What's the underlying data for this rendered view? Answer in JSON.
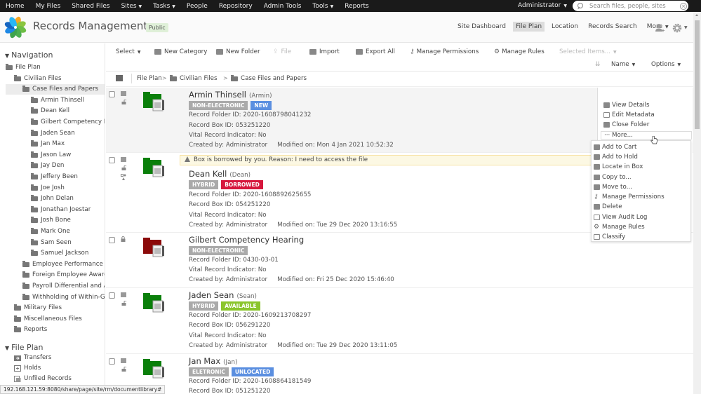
{
  "topbar": {
    "items": [
      {
        "label": "Home"
      },
      {
        "label": "My Files"
      },
      {
        "label": "Shared Files"
      },
      {
        "label": "Sites",
        "has_caret": true
      },
      {
        "label": "Tasks",
        "has_caret": true
      },
      {
        "label": "People"
      },
      {
        "label": "Repository"
      },
      {
        "label": "Admin Tools"
      },
      {
        "label": "Tools",
        "has_caret": true
      },
      {
        "label": "Reports"
      }
    ],
    "user": "Administrator",
    "search_placeholder": "Search files, people, sites"
  },
  "header": {
    "site_title": "Records Management",
    "visibility": "Public",
    "nav": [
      {
        "label": "Site Dashboard",
        "active": false
      },
      {
        "label": "File Plan",
        "active": true
      },
      {
        "label": "Location",
        "active": false
      },
      {
        "label": "Records Search",
        "active": false
      },
      {
        "label": "More",
        "active": false
      }
    ]
  },
  "sidebar": {
    "navigation_title": "Navigation",
    "tree": [
      {
        "label": "File Plan",
        "level": 0
      },
      {
        "label": "Civilian Files",
        "level": 1
      },
      {
        "label": "Case Files and Papers",
        "level": 2,
        "selected": true
      },
      {
        "label": "Armin Thinsell",
        "level": 3
      },
      {
        "label": "Dean Kell",
        "level": 3
      },
      {
        "label": "Gilbert Competency He",
        "level": 3
      },
      {
        "label": "Jaden Sean",
        "level": 3
      },
      {
        "label": "Jan Max",
        "level": 3
      },
      {
        "label": "Jason Law",
        "level": 3
      },
      {
        "label": "Jay Den",
        "level": 3
      },
      {
        "label": "Jeffery Been",
        "level": 3
      },
      {
        "label": "Joe Josh",
        "level": 3
      },
      {
        "label": "John Delan",
        "level": 3
      },
      {
        "label": "Jonathan Joestar",
        "level": 3
      },
      {
        "label": "Josh Bone",
        "level": 3
      },
      {
        "label": "Mark One",
        "level": 3
      },
      {
        "label": "Sam Seen",
        "level": 3
      },
      {
        "label": "Samuel Jackson",
        "level": 3
      },
      {
        "label": "Employee Performance File",
        "level": 2
      },
      {
        "label": "Foreign Employee Award F",
        "level": 2
      },
      {
        "label": "Payroll Differential and Allo",
        "level": 2
      },
      {
        "label": "Withholding of Within-Grad",
        "level": 2
      },
      {
        "label": "Military Files",
        "level": 1
      },
      {
        "label": "Miscellaneous Files",
        "level": 1
      },
      {
        "label": "Reports",
        "level": 1
      }
    ],
    "fileplan_title": "File Plan",
    "fileplan_items": [
      {
        "label": "Transfers"
      },
      {
        "label": "Holds"
      },
      {
        "label": "Unfiled Records"
      }
    ]
  },
  "toolbar": {
    "select": "Select",
    "new_category": "New Category",
    "new_folder": "New Folder",
    "file": "File",
    "import": "Import",
    "export_all": "Export All",
    "manage_permissions": "Manage Permissions",
    "manage_rules": "Manage Rules",
    "selected_items": "Selected Items...",
    "sort_by": "Name",
    "options": "Options"
  },
  "breadcrumb": [
    "File Plan",
    "Civilian Files",
    "Case Files and Papers"
  ],
  "colors": {
    "folder_green": "#0a7f0a",
    "folder_red": "#8b0a0a",
    "badge_gray": "#aaaaaa",
    "badge_new": "#5b8fe0",
    "badge_borrowed": "#d6173d",
    "badge_available": "#8ac52c",
    "badge_unlocated": "#5b8fe0"
  },
  "records": [
    {
      "title": "Armin Thinsell",
      "alias": "(Armin)",
      "badges": [
        {
          "text": "NON-ELECTRONIC",
          "color": "gray"
        },
        {
          "text": "NEW",
          "color": "new"
        }
      ],
      "folder_id": "Record Folder ID: 2020-1608798041232",
      "box_id": "Record Box ID: 053251220",
      "vital": "Vital Record Indicator: No",
      "created": "Created by: Administrator",
      "modified": "Modified on: Mon 4 Jan 2021 10:52:32"
    },
    {
      "warning": "Box is borrowed by you. Reason: I need to access the file",
      "title": "Dean Kell",
      "alias": "(Dean)",
      "badges": [
        {
          "text": "HYBRID",
          "color": "gray"
        },
        {
          "text": "BORROWED",
          "color": "borrowed"
        }
      ],
      "folder_id": "Record Folder ID: 2020-1608892625655",
      "box_id": "Record Box ID: 054251220",
      "vital": "Vital Record Indicator: No",
      "created": "Created by: Administrator",
      "modified": "Modified on: Tue 29 Dec 2020 13:16:55"
    },
    {
      "title": "Gilbert Competency Hearing",
      "alias": "",
      "badges": [
        {
          "text": "NON-ELECTRONIC",
          "color": "gray"
        }
      ],
      "folder_id": "Record Folder ID: 0430-03-01",
      "vital": "Vital Record Indicator: No",
      "created": "Created by: Administrator",
      "modified": "Modified on: Fri 25 Dec 2020 15:46:40"
    },
    {
      "title": "Jaden Sean",
      "alias": "(Sean)",
      "badges": [
        {
          "text": "HYBRID",
          "color": "gray"
        },
        {
          "text": "AVAILABLE",
          "color": "available"
        }
      ],
      "folder_id": "Record Folder ID: 2020-1609213708297",
      "box_id": "Record Box ID: 056291220",
      "vital": "Vital Record Indicator: No",
      "created": "Created by: Administrator",
      "modified": "Modified on: Tue 29 Dec 2020 13:11:05"
    },
    {
      "title": "Jan Max",
      "alias": "(Jan)",
      "badges": [
        {
          "text": "ELETRONIC",
          "color": "gray"
        },
        {
          "text": "UNLOCATED",
          "color": "unlocated"
        }
      ],
      "folder_id": "Record Folder ID: 2020-1608864181549",
      "box_id": "Record Box ID: 051251220"
    }
  ],
  "actions": {
    "view_details": "View Details",
    "edit_metadata": "Edit Metadata",
    "close_folder": "Close Folder",
    "more": "··· More..."
  },
  "more_menu": [
    "Add to Cart",
    "Add to Hold",
    "Locate in Box",
    "Copy to...",
    "Move to...",
    "Manage Permissions",
    "Delete",
    "View Audit Log",
    "Manage Rules",
    "Classify"
  ],
  "status_url": "192.168.121.59:8080/share/page/site/rm/documentlibrary#"
}
